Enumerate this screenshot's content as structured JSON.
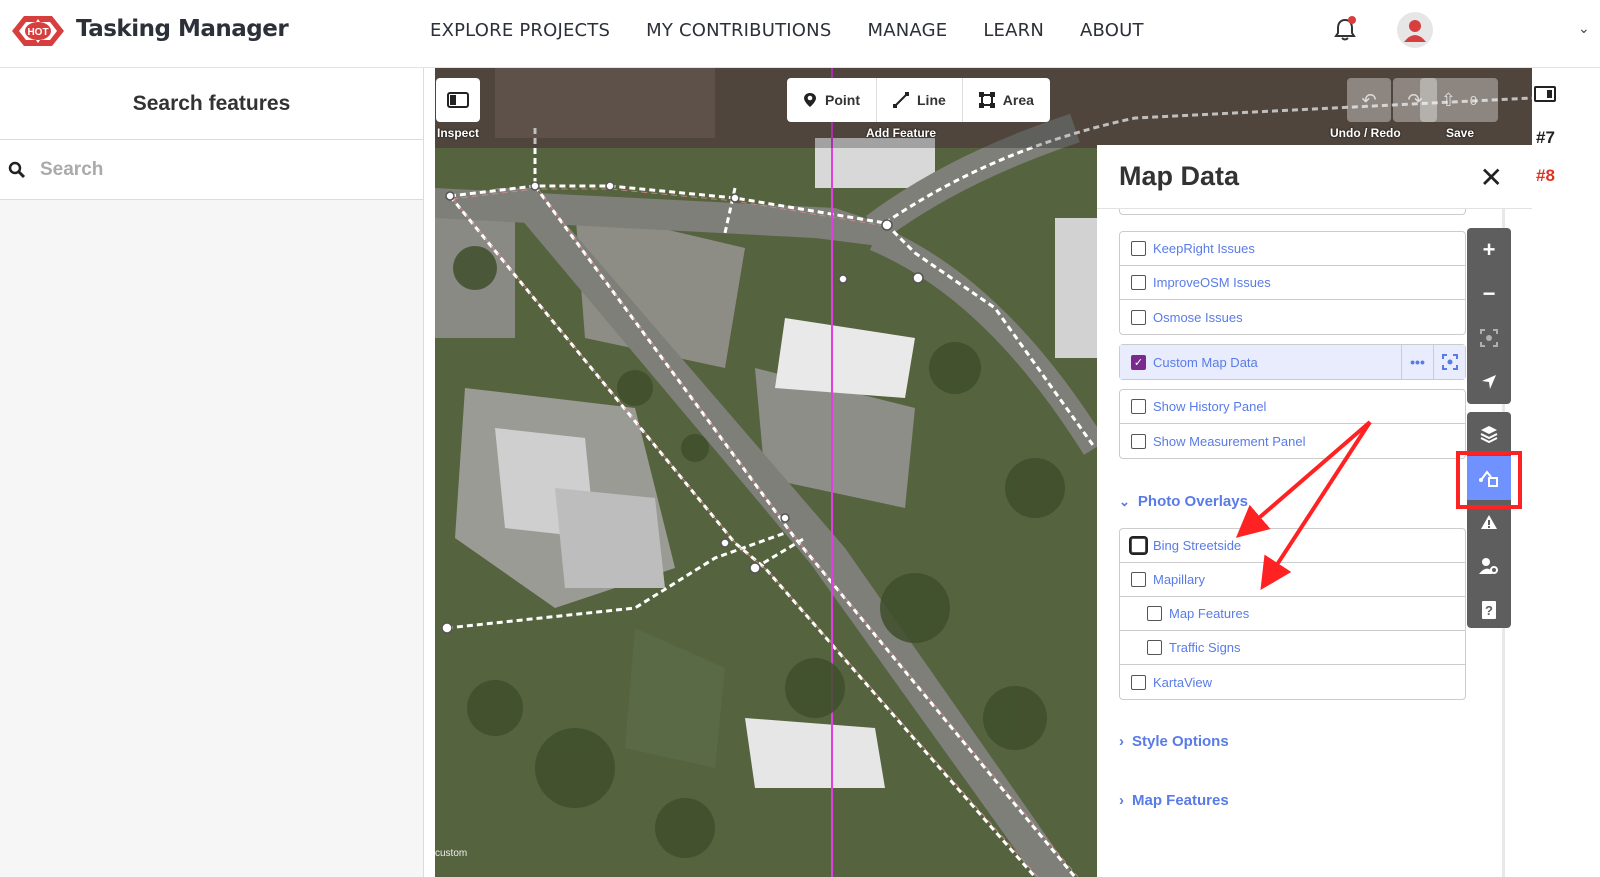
{
  "header": {
    "app_title": "Tasking Manager",
    "logo_text": "HOT",
    "nav": [
      "EXPLORE PROJECTS",
      "MY CONTRIBUTIONS",
      "MANAGE",
      "LEARN",
      "ABOUT"
    ]
  },
  "sidebar": {
    "title": "Search features",
    "search_placeholder": "Search"
  },
  "editor_toolbar": {
    "inspect_label": "Inspect",
    "add_feature_label": "Add Feature",
    "point": "Point",
    "line": "Line",
    "area": "Area",
    "undo_redo_label": "Undo / Redo",
    "save_label": "Save",
    "save_count": "0"
  },
  "map_data_panel": {
    "title": "Map Data",
    "issues_layers": [
      "KeepRight Issues",
      "ImproveOSM Issues",
      "Osmose Issues"
    ],
    "custom_layer": {
      "label": "Custom Map Data",
      "checked": true,
      "more": "•••"
    },
    "panels": [
      "Show History Panel",
      "Show Measurement Panel"
    ],
    "photo_overlays": {
      "title": "Photo Overlays",
      "items": [
        {
          "label": "Bing Streetside",
          "indent": false
        },
        {
          "label": "Mapillary",
          "indent": false
        },
        {
          "label": "Map Features",
          "indent": true
        },
        {
          "label": "Traffic Signs",
          "indent": true
        },
        {
          "label": "KartaView",
          "indent": false
        }
      ]
    },
    "style_options": "Style Options",
    "map_features": "Map Features"
  },
  "gutter": {
    "tag_a": "#7",
    "tag_b": "#8"
  },
  "map": {
    "attribution": "custom"
  },
  "colors": {
    "accent": "#597be7",
    "selected_ctrl": "#7092ff",
    "annotation_red": "#ff2222",
    "guide_line": "#e040e0"
  }
}
